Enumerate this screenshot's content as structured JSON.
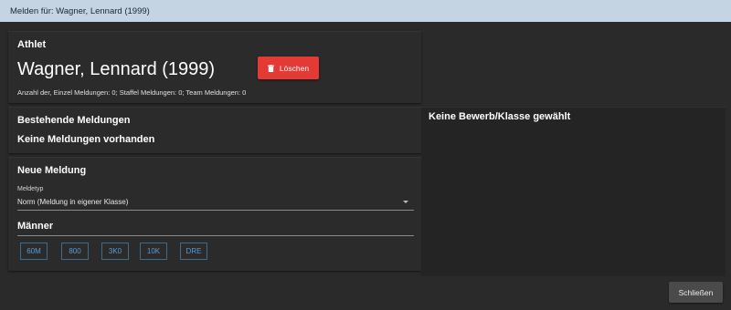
{
  "window": {
    "title": "Melden für: Wagner, Lennard (1999)"
  },
  "athlete": {
    "heading": "Athlet",
    "name": "Wagner, Lennard (1999)",
    "delete_label": "Löschen",
    "summary": "Anzahl der, Einzel Meldungen: 0; Staffel Meldungen: 0; Team Meldungen: 0"
  },
  "existing": {
    "heading": "Bestehende Meldungen",
    "empty_text": "Keine Meldungen vorhanden"
  },
  "new_entry": {
    "heading": "Neue Meldung",
    "type_label": "Meldetyp",
    "type_value": "Norm (Meldung in eigener Klasse)",
    "class_heading": "Männer",
    "events": [
      "60M",
      "800",
      "3K0",
      "10K",
      "DRE"
    ]
  },
  "detail": {
    "empty_text": "Keine Bewerb/Klasse gewählt"
  },
  "footer": {
    "close_label": "Schließen"
  },
  "colors": {
    "titlebar_bg": "#c4d4e3",
    "delete_bg": "#e53935",
    "chip_text": "#5b9bd5",
    "chip_border": "#3d6b8e"
  },
  "icons": {
    "delete": "trash-icon",
    "select": "caret-down-icon"
  }
}
